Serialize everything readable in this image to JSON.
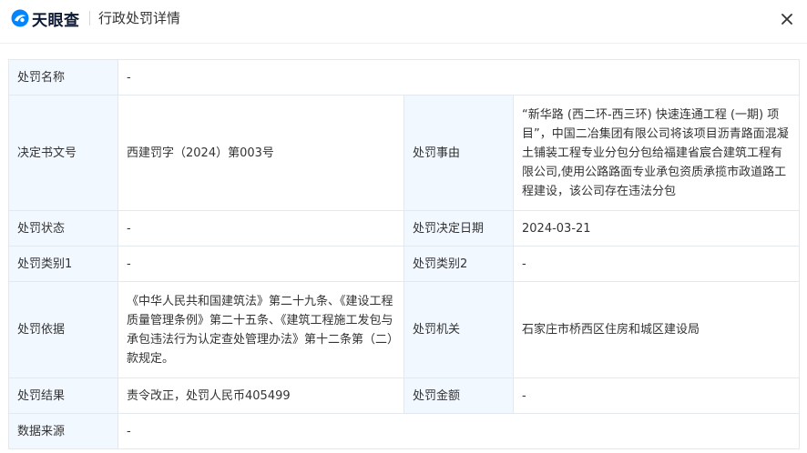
{
  "header": {
    "brand": "天眼查",
    "title": "行政处罚详情",
    "close_icon": "close-icon"
  },
  "colors": {
    "brand_blue": "#0084ff",
    "label_bg": "#f2f8ff",
    "border": "#e4e8ef"
  },
  "rows": {
    "penalty_name": {
      "label": "处罚名称",
      "value": "-"
    },
    "decision_no": {
      "label": "决定书文号",
      "value": "西建罚字（2024）第003号"
    },
    "reason": {
      "label": "处罚事由",
      "value": "“新华路 (西二环-西三环) 快速连通工程 (一期) 项目”，中国二冶集团有限公司将该项目沥青路面混凝土铺装工程专业分包分包给福建省宸合建筑工程有限公司,使用公路路面专业承包资质承揽市政道路工程建设，该公司存在违法分包"
    },
    "status": {
      "label": "处罚状态",
      "value": "-"
    },
    "decision_date": {
      "label": "处罚决定日期",
      "value": "2024-03-21"
    },
    "category1": {
      "label": "处罚类别1",
      "value": "-"
    },
    "category2": {
      "label": "处罚类别2",
      "value": "-"
    },
    "basis": {
      "label": "处罚依据",
      "value": "《中华人民共和国建筑法》第二十九条、《建设工程质量管理条例》第二十五条、《建筑工程施工发包与承包违法行为认定查处管理办法》第十二条第（二）款规定。"
    },
    "authority": {
      "label": "处罚机关",
      "value": "石家庄市桥西区住房和城区建设局"
    },
    "result": {
      "label": "处罚结果",
      "value": "责令改正，处罚人民币405499"
    },
    "amount": {
      "label": "处罚金额",
      "value": "-"
    },
    "source": {
      "label": "数据来源",
      "value": "-"
    }
  }
}
